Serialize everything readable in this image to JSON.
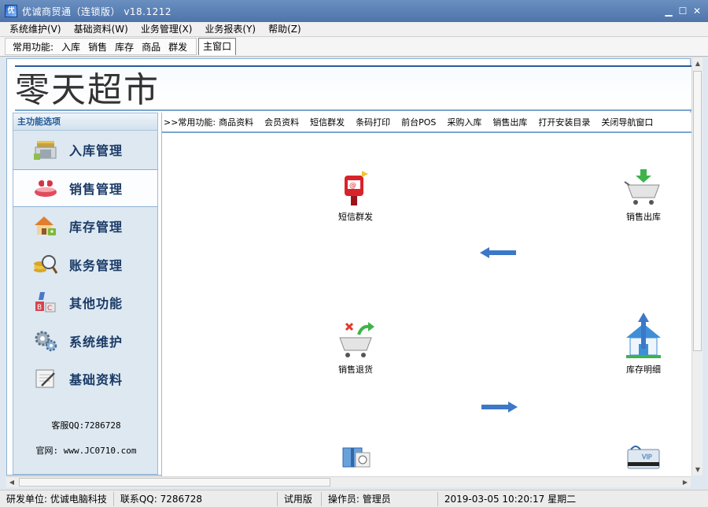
{
  "window": {
    "title": "优诚商贸通（连锁版）   v18.1212"
  },
  "menu": [
    "系统维护(V)",
    "基础资料(W)",
    "业务管理(X)",
    "业务报表(Y)",
    "帮助(Z)"
  ],
  "toolbar": {
    "label": "常用功能:",
    "items": [
      "入库",
      "销售",
      "库存",
      "商品",
      "群发"
    ],
    "active_tab": "主窗口"
  },
  "banner": {
    "store_name": "零天超市"
  },
  "sidebar": {
    "header": "主功能选项",
    "items": [
      {
        "label": "入库管理",
        "icon": "warehouse-icon"
      },
      {
        "label": "销售管理",
        "icon": "gift-basket-icon",
        "active": true
      },
      {
        "label": "库存管理",
        "icon": "house-lock-icon"
      },
      {
        "label": "账务管理",
        "icon": "coins-magnifier-icon"
      },
      {
        "label": "其他功能",
        "icon": "abc-blocks-icon"
      },
      {
        "label": "系统维护",
        "icon": "gears-icon"
      },
      {
        "label": "基础资料",
        "icon": "notepad-pen-icon"
      }
    ],
    "service_qq": "客服QQ:7286728",
    "website": "官网: www.JC0710.com"
  },
  "quickbar": {
    "prefix": ">>常用功能:",
    "links": [
      "商品资料",
      "会员资料",
      "短信群发",
      "条码打印",
      "前台POS",
      "采购入库",
      "销售出库",
      "打开安装目录",
      "关闭导航窗口"
    ]
  },
  "flow": {
    "sms": "短信群发",
    "sales_out": "销售出库",
    "sales_return": "销售退货",
    "stock_detail": "库存明细"
  },
  "status": {
    "developer": "研发单位: 优诚电脑科技",
    "contact": "联系QQ: 7286728",
    "edition": "试用版",
    "operator": "操作员: 管理员",
    "datetime": "2019-03-05 10:20:17 星期二"
  },
  "colors": {
    "titlebar": "#4d74ab",
    "accent": "#2a5c97",
    "sidebar_bg": "#dde8f1",
    "arrow": "#3c78c8"
  }
}
